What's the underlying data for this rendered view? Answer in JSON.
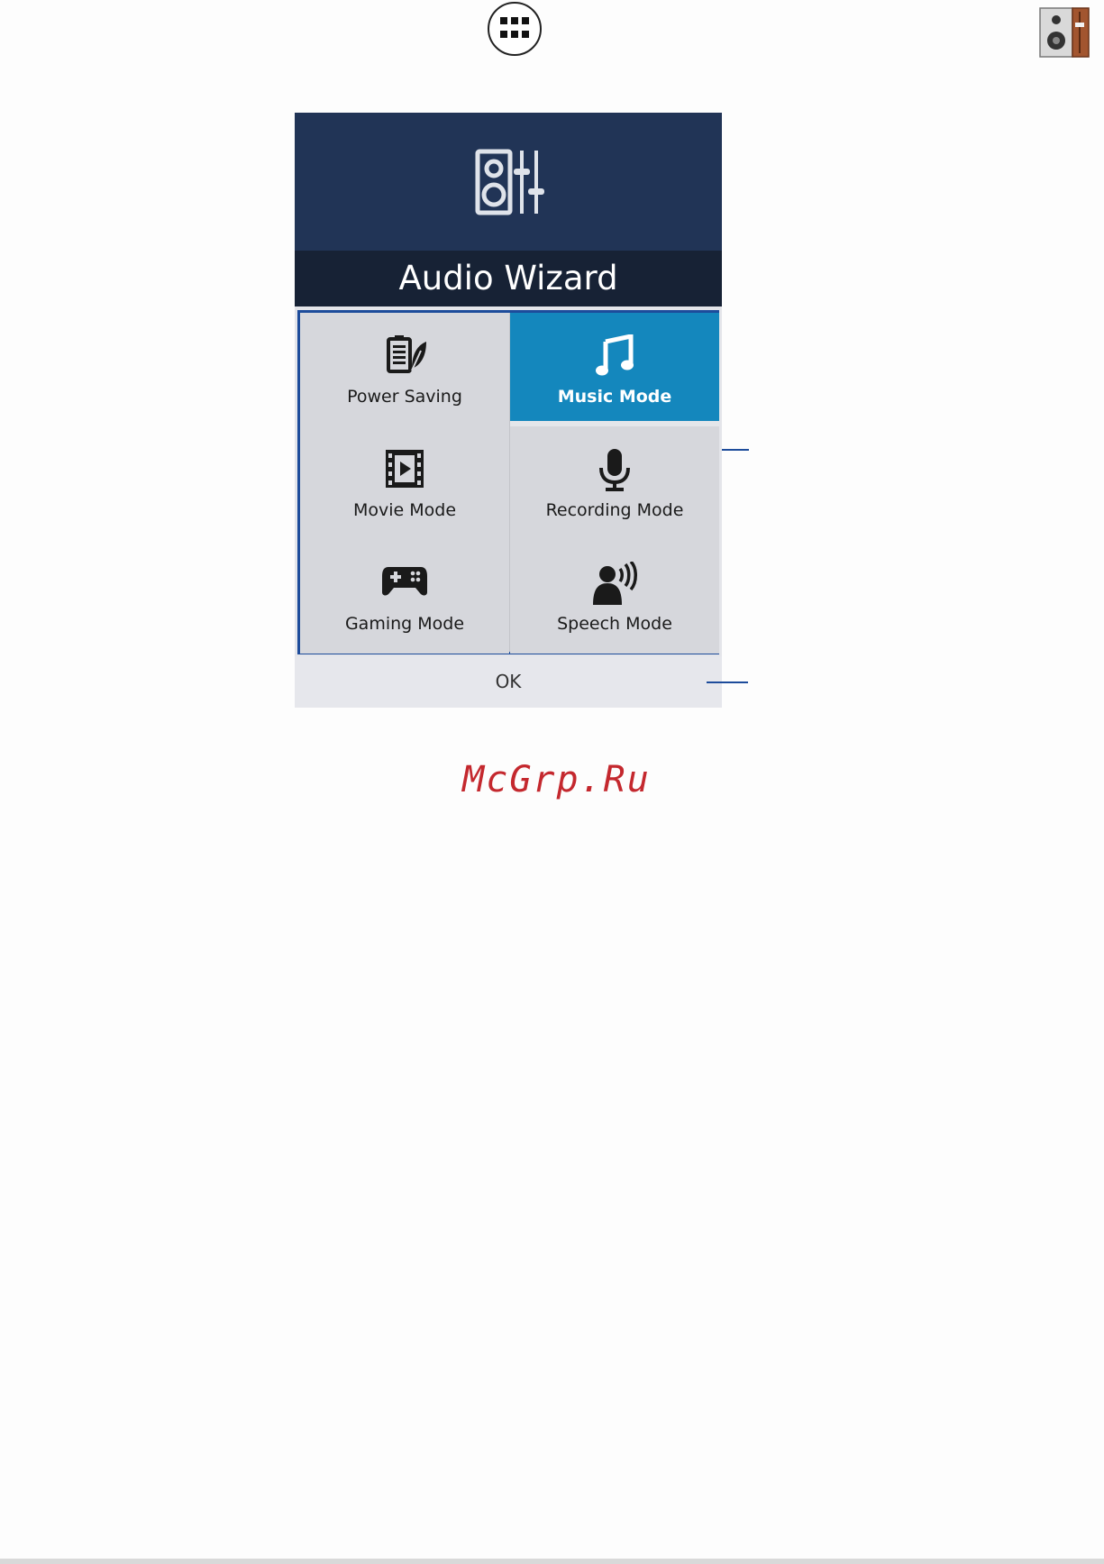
{
  "dialog": {
    "title": "Audio Wizard",
    "modes": [
      {
        "label": "Power Saving",
        "icon": "battery-leaf-icon",
        "selected": false
      },
      {
        "label": "Music Mode",
        "icon": "music-note-icon",
        "selected": true
      },
      {
        "label": "Movie Mode",
        "icon": "film-icon",
        "selected": false
      },
      {
        "label": "Recording Mode",
        "icon": "microphone-icon",
        "selected": false
      },
      {
        "label": "Gaming Mode",
        "icon": "gamepad-icon",
        "selected": false
      },
      {
        "label": "Speech Mode",
        "icon": "speaker-person-icon",
        "selected": false
      }
    ],
    "ok_label": "OK"
  },
  "icons": {
    "apps": "apps-grid-icon",
    "audio_app": "audio-wizard-app-icon",
    "header": "speaker-equalizer-icon"
  },
  "colors": {
    "header": "#213456",
    "title_bar": "#172235",
    "selected": "#1487bd",
    "grid_border": "#1d4c9b",
    "watermark": "#c4282e"
  },
  "watermark": "McGrp.Ru"
}
